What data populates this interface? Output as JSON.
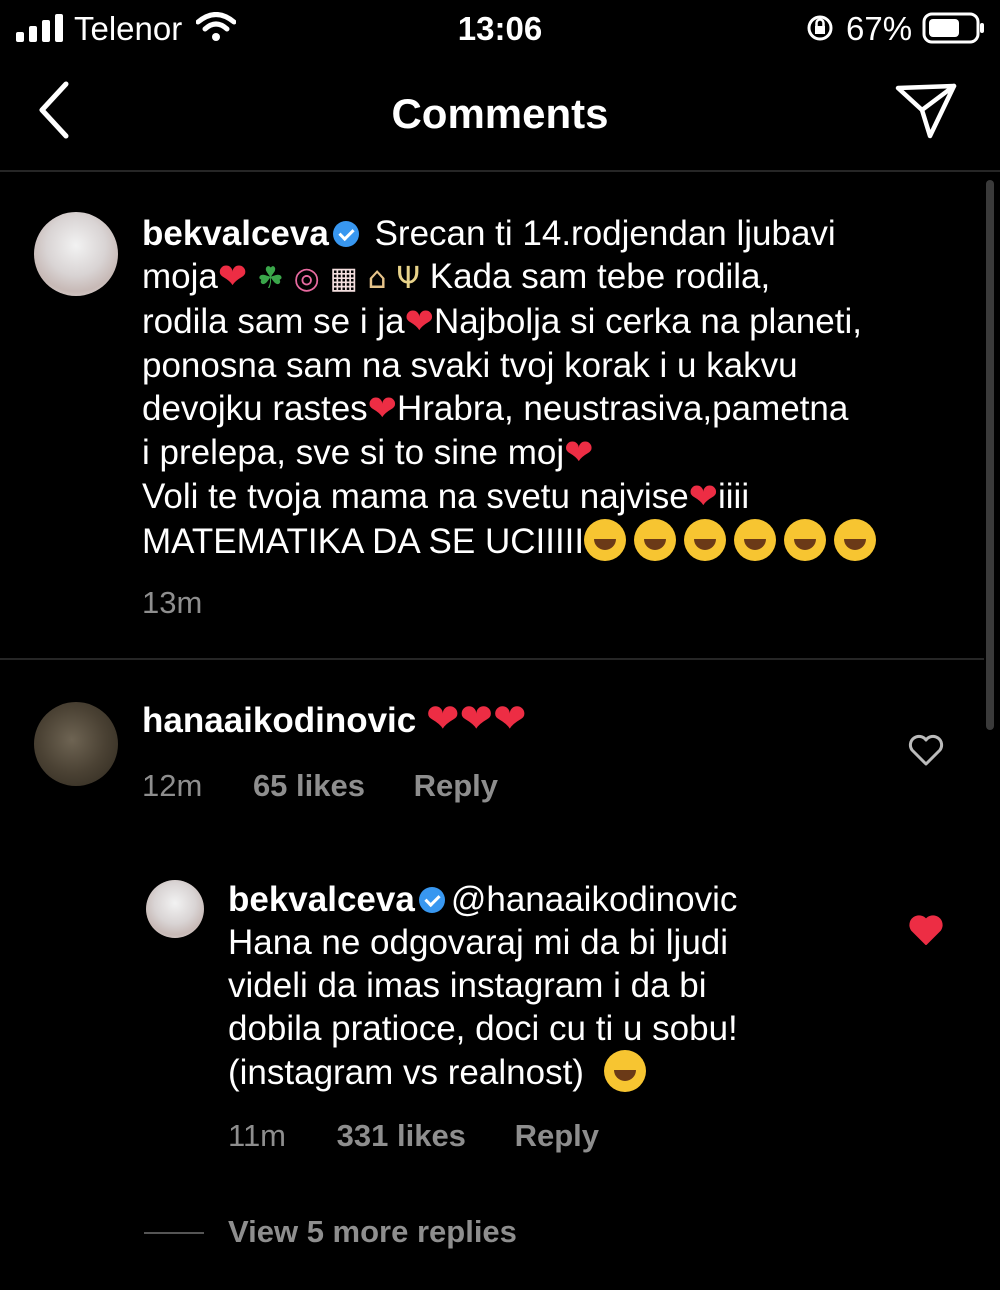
{
  "status_bar": {
    "carrier": "Telenor",
    "time": "13:06",
    "battery": "67%"
  },
  "header": {
    "title": "Comments",
    "back_icon": "chevron-left-icon",
    "send_icon": "paper-plane-icon"
  },
  "caption": {
    "username": "bekvalceva",
    "verified": true,
    "line1": "Srecan ti 14.rodjendan ljubavi",
    "line2a": "moja",
    "line2b": "Kada sam tebe rodila,",
    "line3a": "rodila sam se i ja",
    "line3b": "Najbolja si cerka na planeti,",
    "line4": "ponosna sam na svaki tvoj korak i u kakvu",
    "line5a": "devojku rastes",
    "line5b": "Hrabra, neustrasiva,pametna",
    "line6": "i prelepa, sve  si to sine moj",
    "line7a": "Voli te tvoja mama na svetu najvise",
    "line7b": "iiii",
    "line8": "MATEMATIKA DA SE UCIIIII",
    "time": "13m"
  },
  "comment1": {
    "username": "hanaaikodinovic",
    "time": "12m",
    "likes": "65 likes",
    "reply": "Reply"
  },
  "reply1": {
    "username": "bekvalceva",
    "verified": true,
    "mention": "@hanaaikodinovic",
    "line1": "Hana ne odgovaraj mi da bi ljudi",
    "line2": "videli da imas instagram i da bi",
    "line3": "dobila pratioce, doci cu ti u sobu!",
    "line4": "(instagram vs realnost)",
    "time": "11m",
    "likes": "331 likes",
    "reply": "Reply",
    "liked": true
  },
  "view_more": "View 5 more replies",
  "colors": {
    "background": "#000000",
    "secondary_text": "#8e8e8e",
    "like_red": "#ed2d44",
    "verified_blue": "#3897f0"
  }
}
